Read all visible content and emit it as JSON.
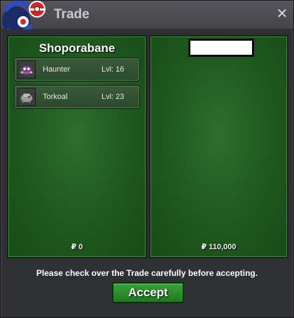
{
  "window": {
    "title": "Trade",
    "close_glyph": "✕"
  },
  "left_panel": {
    "player_name": "Shoporabane",
    "pokemon": [
      {
        "name": "Haunter",
        "level": "Lvl: 16",
        "icon": "haunter-icon"
      },
      {
        "name": "Torkoal",
        "level": "Lvl: 23",
        "icon": "torkoal-icon"
      }
    ],
    "money": "0",
    "currency_symbol": "₽"
  },
  "right_panel": {
    "player_name": "",
    "pokemon": [],
    "money": "110,000",
    "currency_symbol": "₽"
  },
  "footer": {
    "notice": "Please check over the Trade carefully before accepting.",
    "accept_label": "Accept"
  },
  "colors": {
    "panel_green": "#1f5a1f",
    "button_green": "#2e8f2e",
    "window_bg": "#3b3b40"
  }
}
